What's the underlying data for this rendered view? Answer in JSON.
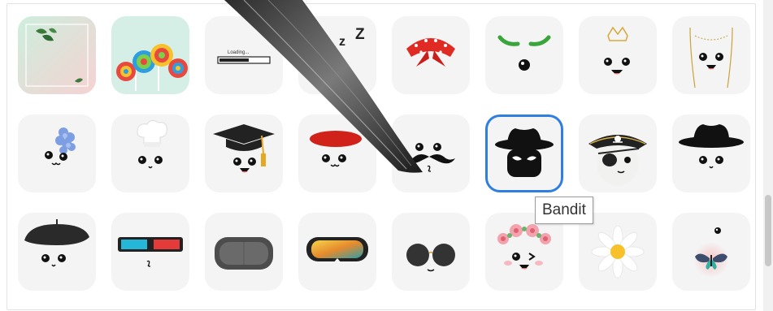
{
  "tooltip": {
    "text": "Bandit"
  },
  "loading": {
    "text": "Loading..."
  },
  "zzz": {
    "z1": "z",
    "z2": "z",
    "z3": "Z"
  },
  "stickers": [
    {
      "id": "leaf-frame"
    },
    {
      "id": "lollipops"
    },
    {
      "id": "loading-bar"
    },
    {
      "id": "sleepy-zzz"
    },
    {
      "id": "red-bandana"
    },
    {
      "id": "green-antennae"
    },
    {
      "id": "crown"
    },
    {
      "id": "gold-necklace"
    },
    {
      "id": "hydrangea"
    },
    {
      "id": "chef-hat"
    },
    {
      "id": "graduation-cap"
    },
    {
      "id": "red-beret"
    },
    {
      "id": "mustache"
    },
    {
      "id": "bandit",
      "selected": true
    },
    {
      "id": "pirate"
    },
    {
      "id": "black-hat"
    },
    {
      "id": "black-beret"
    },
    {
      "id": "3d-glasses"
    },
    {
      "id": "vr-headset"
    },
    {
      "id": "ski-goggles"
    },
    {
      "id": "round-sunglasses"
    },
    {
      "id": "flower-crown"
    },
    {
      "id": "daisy"
    },
    {
      "id": "butterfly"
    }
  ]
}
